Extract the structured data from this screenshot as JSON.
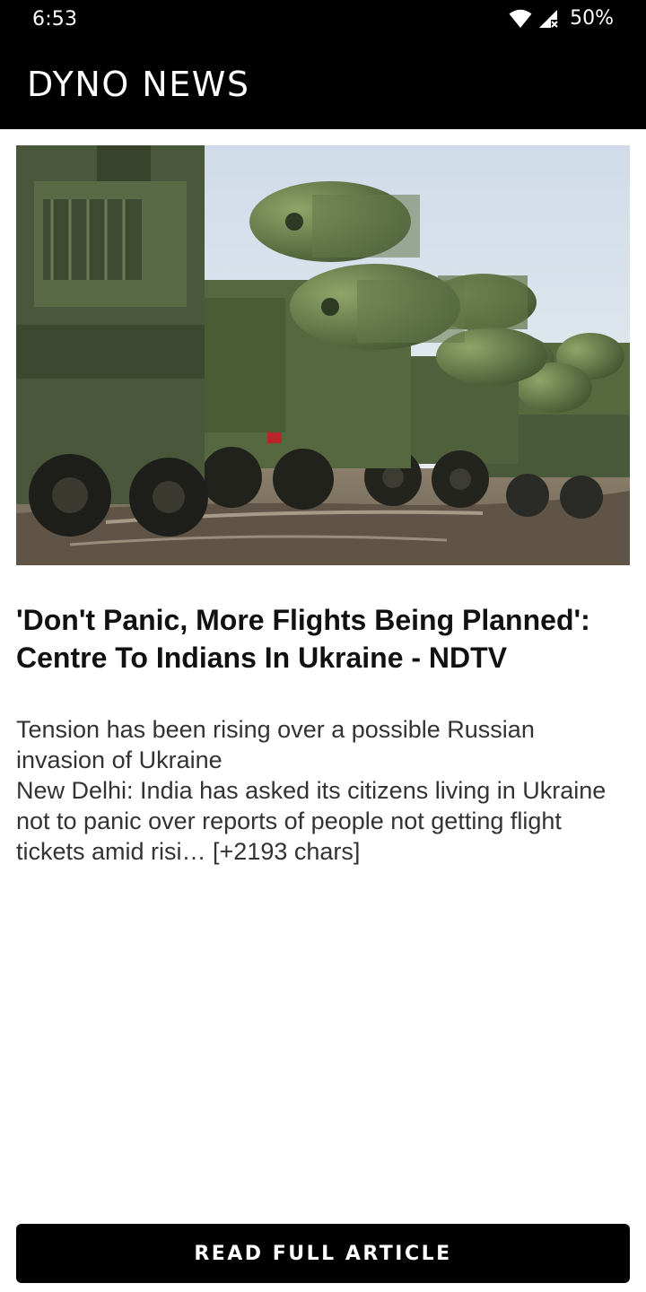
{
  "status_bar": {
    "time": "6:53",
    "battery": "50%",
    "icons": [
      "wifi-icon",
      "cell-signal-icon"
    ]
  },
  "app_bar": {
    "title": "DYNO NEWS"
  },
  "article": {
    "image_icon": "military-trucks-photo",
    "headline": "'Don't Panic, More Flights Being Planned': Centre To Indians In Ukraine - NDTV",
    "description_line1": "Tension has been rising over a possible Russian invasion of Ukraine",
    "description_line2": "New Delhi: India has asked its citizens living in Ukraine not to panic over reports of people not getting flight tickets amid risi… [+2193 chars]"
  },
  "actions": {
    "read_full_label": "READ FULL ARTICLE"
  },
  "colors": {
    "app_bar": "#000000",
    "background": "#ffffff",
    "button": "#000000",
    "button_text": "#ffffff"
  }
}
